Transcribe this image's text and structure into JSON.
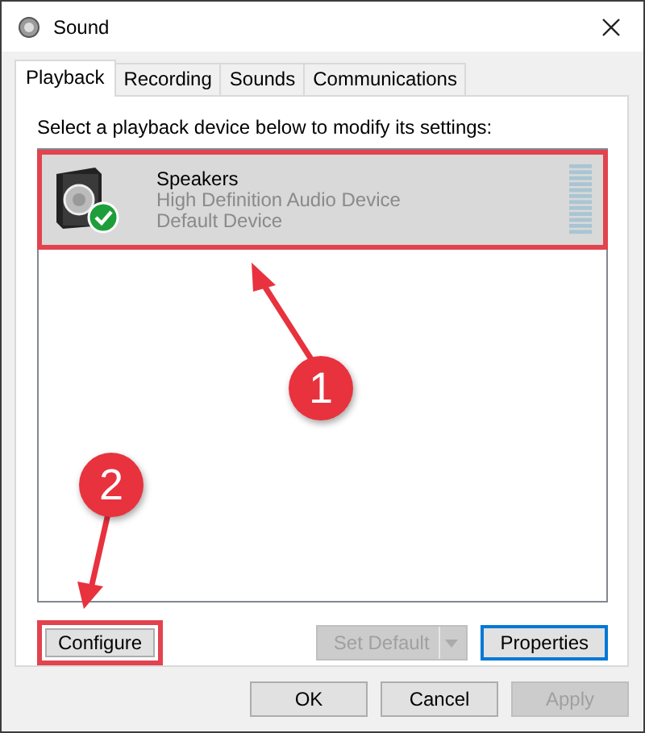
{
  "window": {
    "title": "Sound"
  },
  "tabs": [
    {
      "label": "Playback",
      "selected": true
    },
    {
      "label": "Recording",
      "selected": false
    },
    {
      "label": "Sounds",
      "selected": false
    },
    {
      "label": "Communications",
      "selected": false
    }
  ],
  "instruction": "Select a playback device below to modify its settings:",
  "devices": [
    {
      "name": "Speakers",
      "description": "High Definition Audio Device",
      "status": "Default Device",
      "selected": true,
      "default": true,
      "highlighted": true
    }
  ],
  "device_buttons": [
    {
      "label": "Configure",
      "disabled": false,
      "focused": false,
      "highlighted": true,
      "dropdown": false
    },
    {
      "label": "Set Default",
      "disabled": true,
      "focused": false,
      "highlighted": false,
      "dropdown": true
    },
    {
      "label": "Properties",
      "disabled": false,
      "focused": true,
      "highlighted": false,
      "dropdown": false
    }
  ],
  "dialog_buttons": [
    {
      "label": "OK",
      "disabled": false
    },
    {
      "label": "Cancel",
      "disabled": false
    },
    {
      "label": "Apply",
      "disabled": true
    }
  ],
  "callouts": [
    {
      "number": "1"
    },
    {
      "number": "2"
    }
  ]
}
